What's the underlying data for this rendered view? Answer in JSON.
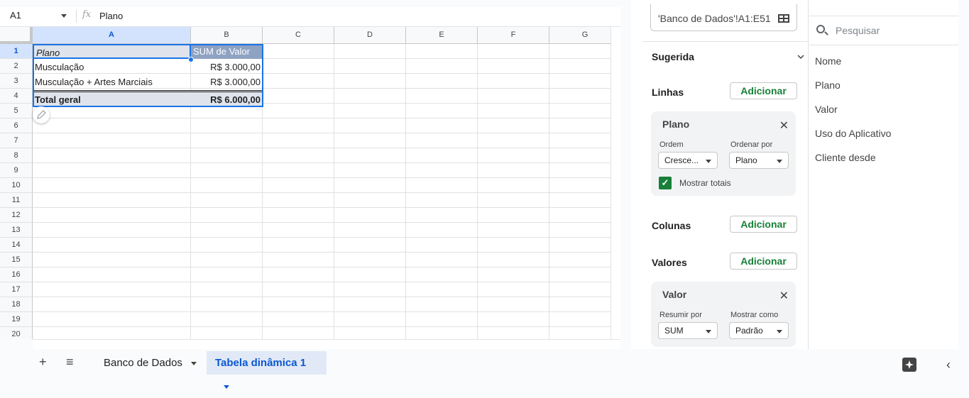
{
  "formula_bar": {
    "cell_ref": "A1",
    "fx": "fx",
    "content": "Plano"
  },
  "columns": [
    "A",
    "B",
    "C",
    "D",
    "E",
    "F",
    "G"
  ],
  "rows": [
    "1",
    "2",
    "3",
    "4",
    "5",
    "6",
    "7",
    "8",
    "9",
    "10",
    "11",
    "12",
    "13",
    "14",
    "15",
    "16",
    "17",
    "18",
    "19",
    "20"
  ],
  "pivot": {
    "header": {
      "a": "Plano",
      "b": "SUM de Valor"
    },
    "rows": [
      {
        "a": "Musculação",
        "b": "R$ 3.000,00"
      },
      {
        "a": "Musculação + Artes Marciais",
        "b": "R$ 3.000,00"
      }
    ],
    "total": {
      "a": "Total geral",
      "b": "R$ 6.000,00"
    }
  },
  "sheet_tabs": {
    "add": "+",
    "menu": "≡",
    "tabs": [
      {
        "label": "Banco de Dados"
      },
      {
        "label": "Tabela dinâmica 1"
      }
    ]
  },
  "editor": {
    "range": "'Banco de Dados'!A1:E51",
    "suggested": "Sugerida",
    "rows_label": "Linhas",
    "columns_label": "Colunas",
    "values_label": "Valores",
    "add_label": "Adicionar",
    "row_card": {
      "title": "Plano",
      "order_label": "Ordem",
      "order_value": "Cresce...",
      "sort_by_label": "Ordenar por",
      "sort_by_value": "Plano",
      "show_totals": "Mostrar totais"
    },
    "value_card": {
      "title": "Valor",
      "summarize_label": "Resumir por",
      "summarize_value": "SUM",
      "show_as_label": "Mostrar como",
      "show_as_value": "Padrão"
    }
  },
  "fields": {
    "search_placeholder": "Pesquisar",
    "items": [
      "Nome",
      "Plano",
      "Valor",
      "Uso do Aplicativo",
      "Cliente desde"
    ]
  },
  "colors": {
    "accent": "#0b57d0",
    "green": "#188038",
    "pivot_header": "#8ea2c2",
    "pivot_total": "#dfe4ec"
  }
}
